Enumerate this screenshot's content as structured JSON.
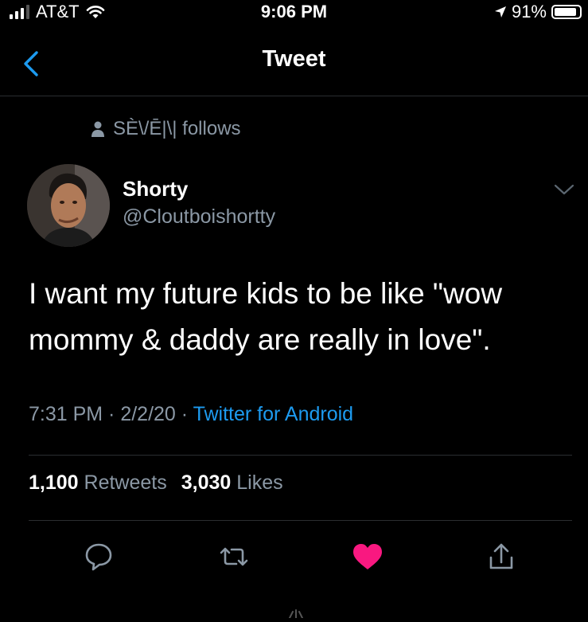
{
  "status_bar": {
    "carrier": "AT&T",
    "time": "9:06 PM",
    "battery_percent_label": "91%",
    "battery_level": 0.91
  },
  "nav": {
    "title": "Tweet"
  },
  "social_context": {
    "text": "SÈ\\/Ē|\\| follows"
  },
  "tweet": {
    "author_name": "Shorty",
    "author_handle": "@Cloutboishortty",
    "text_line1": "I want my future kids to be like \"wow",
    "text_line2": "mommy & daddy are really in love\".",
    "time": "7:31 PM",
    "sep1": " · ",
    "date": "2/2/20",
    "sep2": " · ",
    "source": "Twitter for Android",
    "retweets_count": "1,100",
    "retweets_label": "Retweets",
    "likes_count": "3,030",
    "likes_label": "Likes"
  },
  "colors": {
    "background": "#000000",
    "text_primary": "#ffffff",
    "text_secondary": "#8b98a5",
    "link": "#1d9bf0",
    "like": "#f91880",
    "divider": "#2a2d30"
  },
  "icons": {
    "back": "chevron-left-icon",
    "social_context": "person-icon",
    "caret": "chevron-down-icon",
    "reply": "reply-icon",
    "retweet": "retweet-icon",
    "like": "heart-filled-icon",
    "share": "share-icon"
  }
}
